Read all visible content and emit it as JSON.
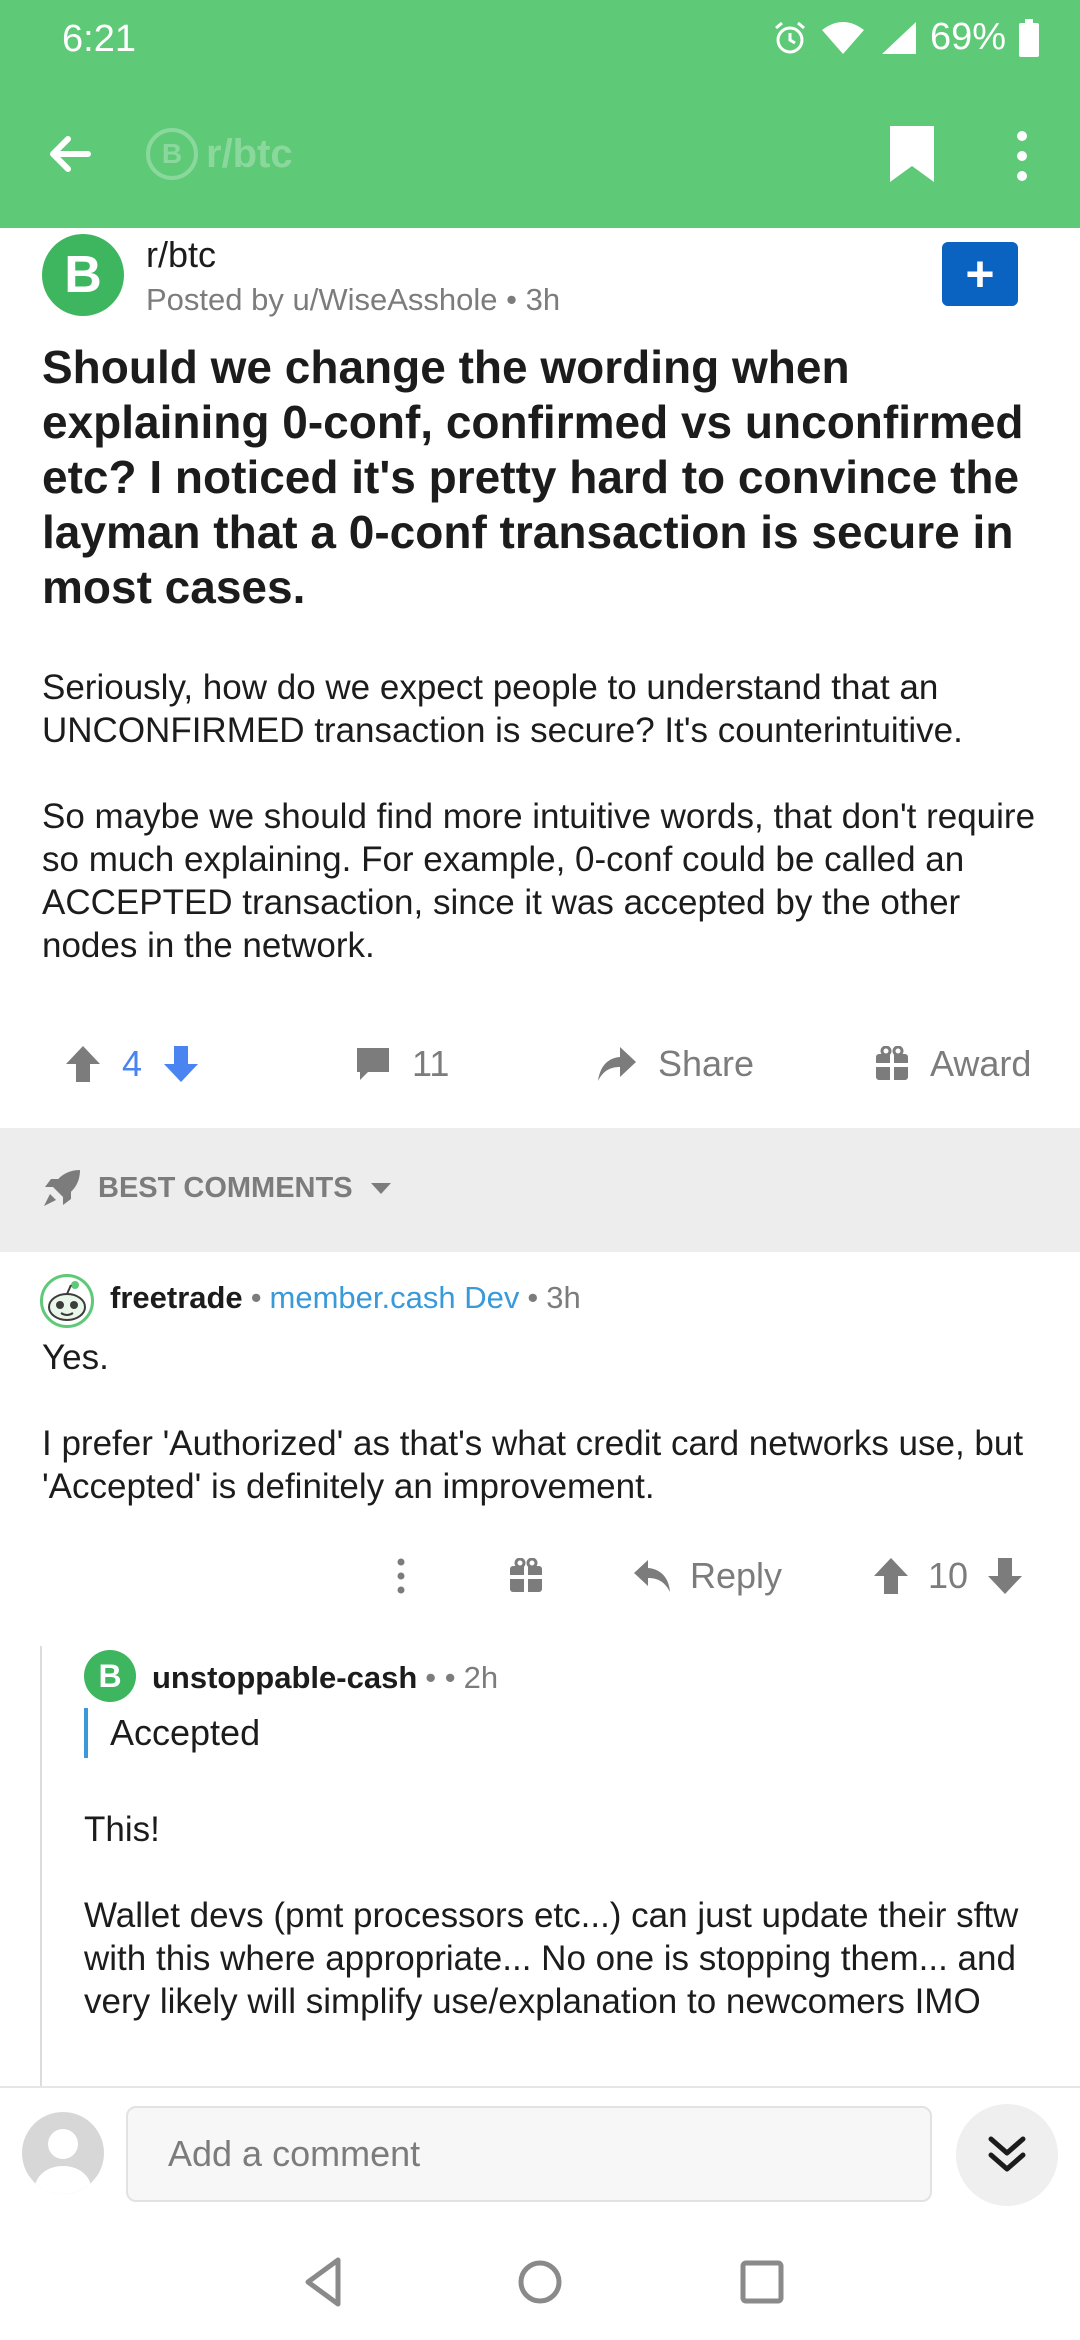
{
  "status": {
    "time": "6:21",
    "battery": "69%"
  },
  "appbar": {
    "subreddit": "r/btc",
    "coin_glyph": "B"
  },
  "post": {
    "avatar_glyph": "B",
    "subreddit": "r/btc",
    "meta": "Posted by u/WiseAsshole • 3h",
    "join_glyph": "+",
    "title": "Should we change the wording when explaining 0-conf, confirmed vs unconfirmed etc? I noticed it's pretty hard to convince the layman that a 0-conf transaction is secure in most cases.",
    "body": [
      "Seriously, how do we expect people to understand that an UNCONFIRMED transaction is secure? It's counterintuitive.",
      "So maybe we should find more intuitive words, that don't require so much explaining. For example, 0-conf could be called an ACCEPTED transaction, since it was accepted by the other nodes in the network."
    ],
    "actions": {
      "score": "4",
      "comments": "11",
      "share": "Share",
      "award": "Award"
    }
  },
  "sort": {
    "label": "BEST COMMENTS"
  },
  "comments": [
    {
      "user": "freetrade",
      "sep1": "•",
      "flair": "member.cash Dev",
      "sep2": "•",
      "age": "3h",
      "body": [
        "Yes.",
        "I prefer 'Authorized' as that's what credit card networks use, but 'Accepted' is definitely an improvement."
      ],
      "actions": {
        "reply": "Reply",
        "score": "10"
      }
    },
    {
      "avatar_glyph": "B",
      "user": "unstoppable-cash",
      "sep": "• •",
      "age": "2h",
      "quote": "Accepted",
      "body": [
        "This!",
        "Wallet devs (pmt processors etc...) can just update their sftw with this where appropriate...   No one is stopping them... and very likely will simplify use/explanation to newcomers IMO"
      ]
    }
  ],
  "composer": {
    "placeholder": "Add a comment"
  },
  "colors": {
    "header": "#5ec977",
    "upvote_active": "#4a84f0",
    "join": "#0a62c1",
    "flair": "#3a9ad9"
  },
  "icons": [
    "back-arrow-icon",
    "bookmark-icon",
    "more-vertical-icon",
    "upvote-icon",
    "downvote-icon",
    "comment-icon",
    "share-icon",
    "award-icon",
    "rocket-icon",
    "chevron-down-icon",
    "reply-icon"
  ]
}
